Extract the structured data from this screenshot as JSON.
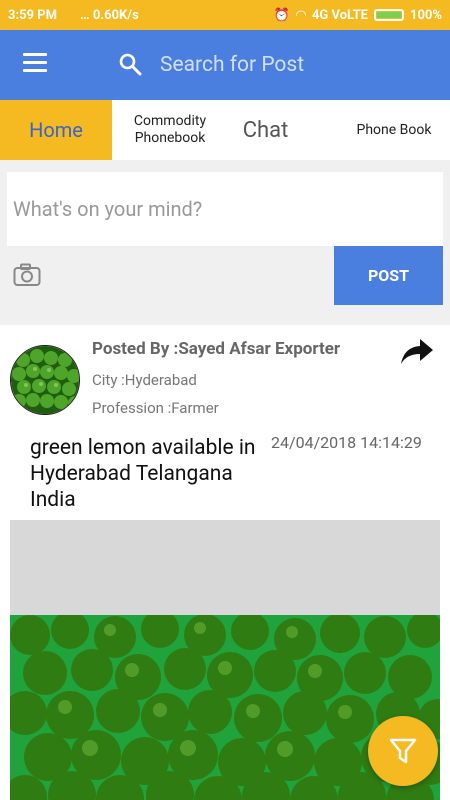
{
  "status": {
    "time": "3:59 PM",
    "speed": "0.60K/s",
    "network": "4G VoLTE",
    "battery": "100%"
  },
  "search": {
    "placeholder": "Search for Post"
  },
  "tabs": [
    {
      "label": "Home"
    },
    {
      "label_line1": "Commodity",
      "label_line2": "Phonebook"
    },
    {
      "label": "Chat"
    },
    {
      "label": "Phone Book"
    }
  ],
  "compose": {
    "placeholder": "What's on your mind?",
    "post_label": "POST"
  },
  "post": {
    "posted_by": "Posted By :Sayed Afsar Exporter",
    "city": "City :Hyderabad",
    "profession": "Profession :Farmer",
    "text": "green lemon available in Hyderabad Telangana India",
    "date": "24/04/2018 14:14:29"
  },
  "colors": {
    "accent": "#4a7fe0",
    "highlight": "#f5b922"
  },
  "icons": [
    "menu-icon",
    "search-icon",
    "camera-icon",
    "share-icon",
    "filter-icon"
  ]
}
